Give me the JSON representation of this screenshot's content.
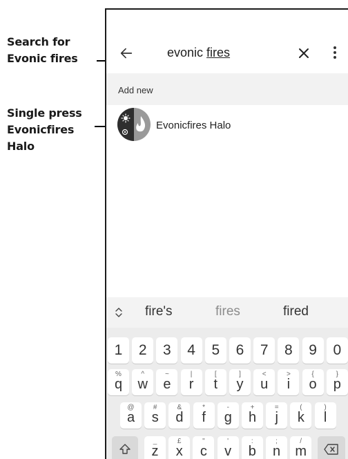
{
  "annotations": {
    "search": [
      "Search for",
      "Evonic fires"
    ],
    "press": [
      "Single press",
      "Evonicfires",
      "Halo"
    ]
  },
  "search": {
    "query_prefix": "evonic ",
    "query_underlined": "fires"
  },
  "add_new": {
    "label": "Add new"
  },
  "results": [
    {
      "label": "Evonicfires Halo"
    }
  ],
  "keyboard": {
    "suggestions": [
      "fire's",
      "fires",
      "fired"
    ],
    "number_row": [
      "1",
      "2",
      "3",
      "4",
      "5",
      "6",
      "7",
      "8",
      "9",
      "0"
    ],
    "row1": [
      {
        "main": "q",
        "sup": "%"
      },
      {
        "main": "w",
        "sup": "^"
      },
      {
        "main": "e",
        "sup": "~"
      },
      {
        "main": "r",
        "sup": "|"
      },
      {
        "main": "t",
        "sup": "["
      },
      {
        "main": "y",
        "sup": "]"
      },
      {
        "main": "u",
        "sup": "<"
      },
      {
        "main": "i",
        "sup": ">"
      },
      {
        "main": "o",
        "sup": "{"
      },
      {
        "main": "p",
        "sup": "}"
      }
    ],
    "row2": [
      {
        "main": "a",
        "sup": "@"
      },
      {
        "main": "s",
        "sup": "#"
      },
      {
        "main": "d",
        "sup": "&"
      },
      {
        "main": "f",
        "sup": "*"
      },
      {
        "main": "g",
        "sup": "-"
      },
      {
        "main": "h",
        "sup": "+"
      },
      {
        "main": "j",
        "sup": "="
      },
      {
        "main": "k",
        "sup": "("
      },
      {
        "main": "l",
        "sup": ")"
      }
    ],
    "row3": [
      {
        "main": "z",
        "sup": "_"
      },
      {
        "main": "x",
        "sup": "£"
      },
      {
        "main": "c",
        "sup": "\""
      },
      {
        "main": "v",
        "sup": "'"
      },
      {
        "main": "b",
        "sup": ":"
      },
      {
        "main": "n",
        "sup": ";"
      },
      {
        "main": "m",
        "sup": "/"
      }
    ]
  },
  "icons": {
    "back": "arrow-left-icon",
    "clear": "close-icon",
    "more": "more-vert-icon",
    "shift": "shift-icon",
    "backspace": "backspace-icon",
    "suggest_toggle": "chevron-updown-icon"
  },
  "colors": {
    "add_new_bg": "#f2f2f2",
    "keyboard_bg": "#ececec",
    "icon_dark": "#2e2e2e",
    "icon_light": "#9a9a9a"
  }
}
